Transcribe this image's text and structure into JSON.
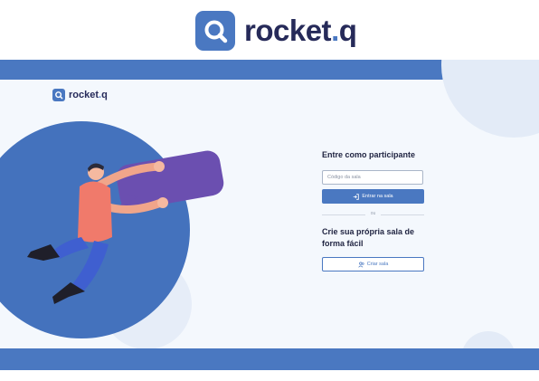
{
  "brand": {
    "name_main": "rocket",
    "name_dot": ".",
    "name_end": "q"
  },
  "app_logo": {
    "name_main": "rocket",
    "name_dot": ".",
    "name_end": "q"
  },
  "illustration": {
    "description_icon": "person-holding-chat-bubble"
  },
  "join": {
    "title": "Entre como participante",
    "code_placeholder": "Código da sala",
    "code_value": "",
    "enter_label": "Entrar na sala",
    "enter_icon": "login-icon"
  },
  "divider": {
    "label": "ou"
  },
  "create": {
    "title": "Crie sua própria sala de forma fácil",
    "button_label": "Criar sala",
    "button_icon": "users-icon"
  },
  "colors": {
    "primary": "#4a78c1",
    "dark": "#262a59",
    "background": "#f4f8fd",
    "bubble": "#6b4fb0"
  }
}
